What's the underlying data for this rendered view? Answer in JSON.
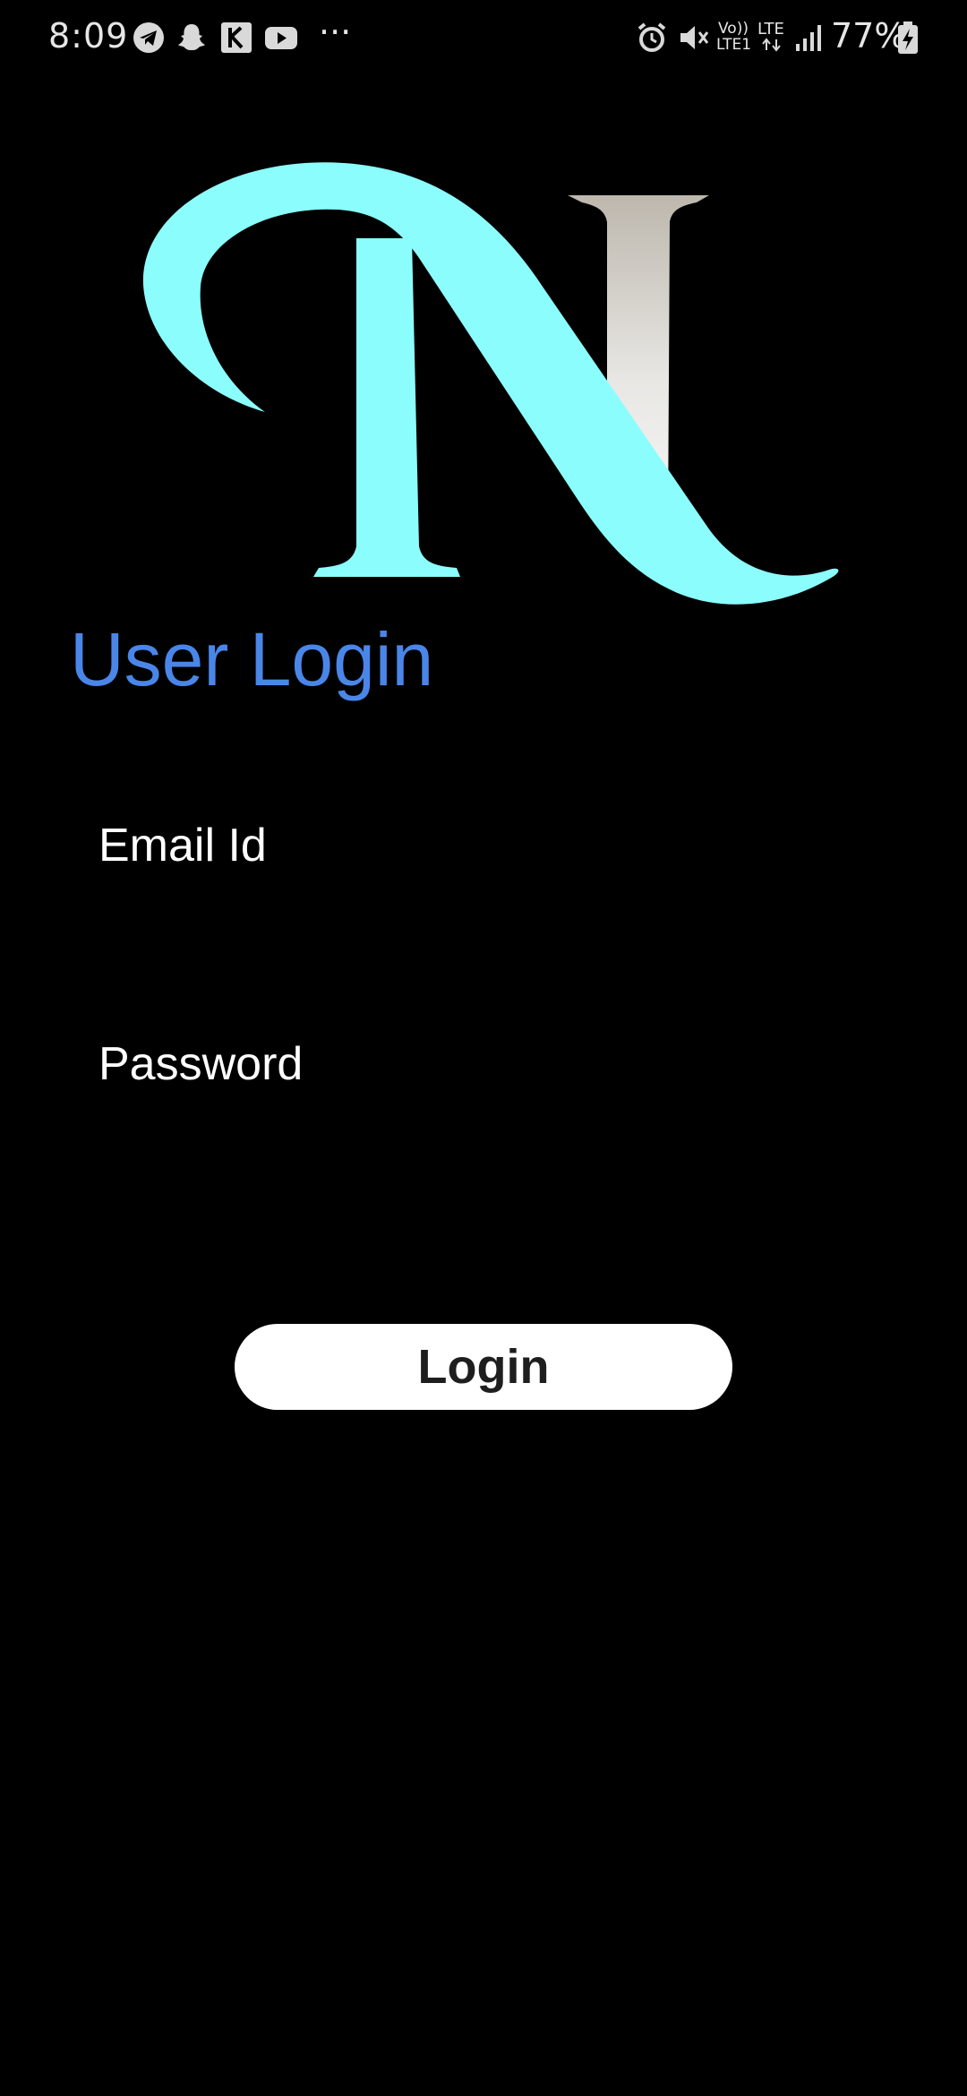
{
  "status_bar": {
    "time": "8:09",
    "battery_percent": "77%",
    "network_label_top": "Vo))",
    "network_label_bottom": "LTE1",
    "lte_label": "LTE",
    "more_dots": "···",
    "left_icons": [
      "telegram-icon",
      "snapchat-icon",
      "k-app-icon",
      "youtube-icon"
    ],
    "right_icons": [
      "alarm-icon",
      "mute-icon",
      "signal-icon",
      "battery-charging-icon"
    ]
  },
  "logo": {
    "name": "N logo",
    "colors": {
      "swoosh": "#8cfdfd",
      "bar_light": "#f2f2f2",
      "bar_dark": "#bdb7ad"
    }
  },
  "login": {
    "title": "User Login",
    "email_label": "Email Id",
    "email_value": "",
    "password_label": "Password",
    "password_value": "",
    "button_label": "Login"
  },
  "colors": {
    "background": "#000000",
    "title": "#4a86e8",
    "button_bg": "#ffffff",
    "button_text": "#1e1e1e"
  }
}
